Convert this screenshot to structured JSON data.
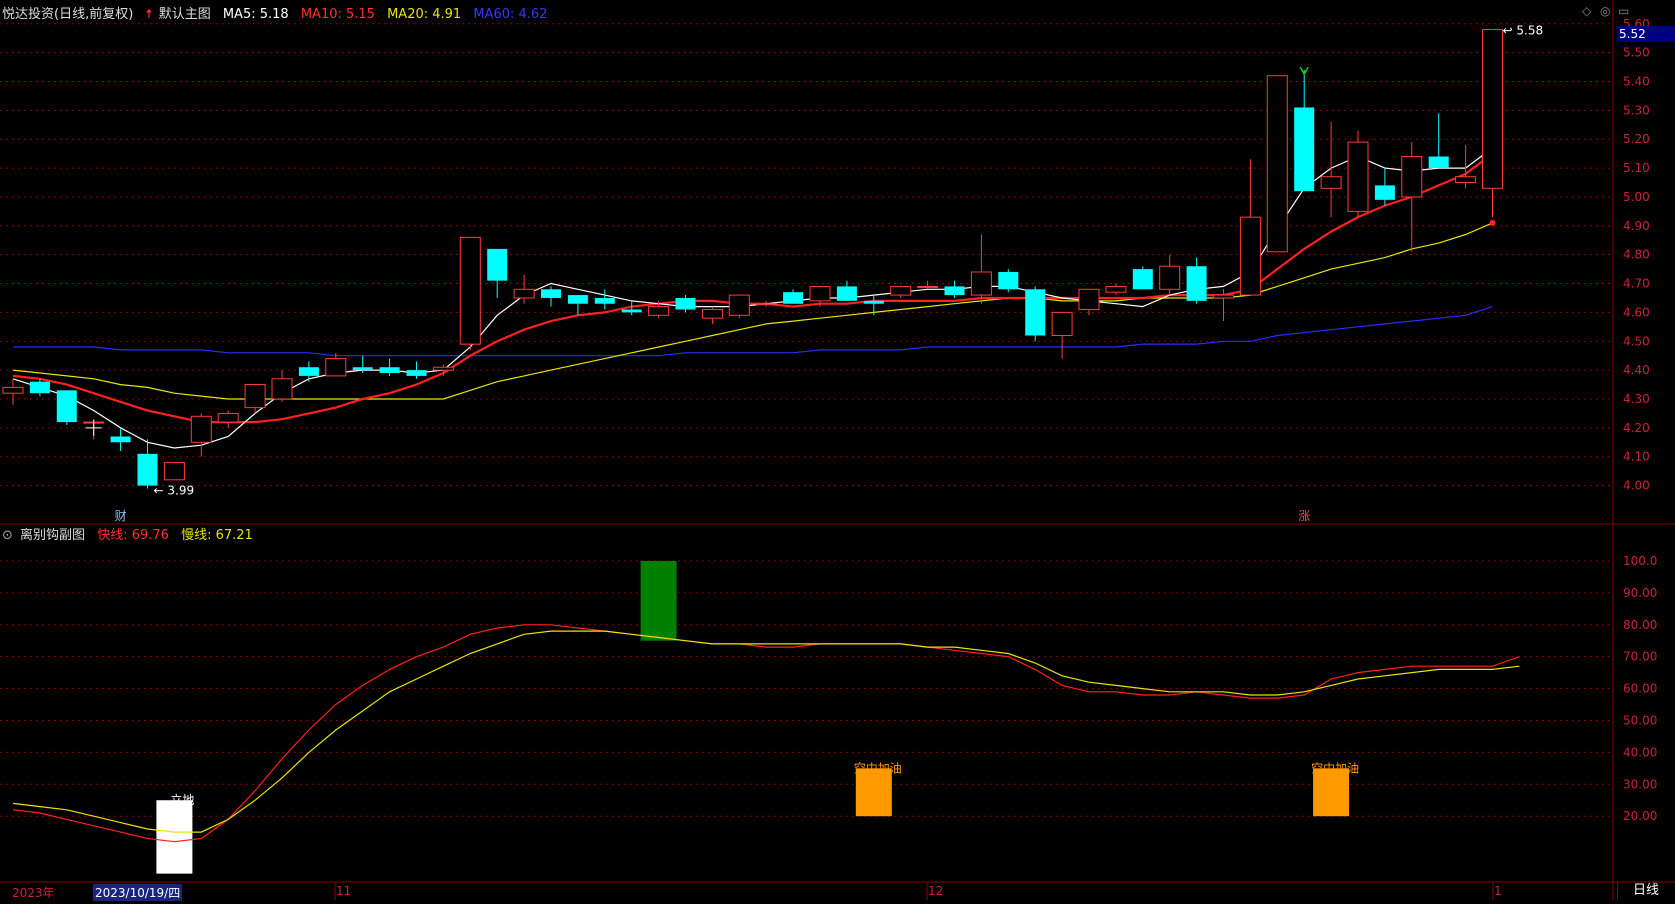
{
  "main_header": {
    "title": "悦达投资(日线,前复权)",
    "arrow_icon": "up-arrow-icon",
    "template": "默认主图",
    "ma5": "MA5: 5.18",
    "ma10": "MA10: 5.15",
    "ma20": "MA20: 4.91",
    "ma60": "MA60: 4.62",
    "colors": {
      "ma5": "#ffffff",
      "ma10": "#ff3030",
      "ma20": "#e6e600",
      "ma60": "#3030ff"
    }
  },
  "sub_header": {
    "title": "离别钩副图",
    "fast": "快线: 69.76",
    "slow": "慢线: 67.21"
  },
  "bottom_bar": {
    "year": "2023年",
    "cursor_date": "2023/10/19/四",
    "months": [
      "11",
      "12",
      "1"
    ],
    "period_button": "日线"
  },
  "price_tag": "5.52",
  "colors": {
    "up": "#ff3b3b",
    "down": "#00ffff",
    "grid": "#8b0000",
    "bg": "#000000"
  },
  "chart_data": [
    {
      "type": "candlestick",
      "title": "悦达投资(日线,前复权)",
      "ylim": [
        3.95,
        5.62
      ],
      "yticks": [
        "4.00",
        "4.10",
        "4.20",
        "4.30",
        "4.40",
        "4.50",
        "4.60",
        "4.70",
        "4.80",
        "4.90",
        "5.00",
        "5.10",
        "5.20",
        "5.30",
        "5.40",
        "5.50",
        "5.60"
      ],
      "candles": [
        {
          "o": 4.32,
          "h": 4.37,
          "l": 4.28,
          "c": 4.34
        },
        {
          "o": 4.36,
          "h": 4.37,
          "l": 4.31,
          "c": 4.32
        },
        {
          "o": 4.33,
          "h": 4.33,
          "l": 4.21,
          "c": 4.22
        },
        {
          "o": 4.22,
          "h": 4.23,
          "l": 4.16,
          "c": 4.22
        },
        {
          "o": 4.17,
          "h": 4.2,
          "l": 4.12,
          "c": 4.15
        },
        {
          "o": 4.11,
          "h": 4.16,
          "l": 3.99,
          "c": 4.0
        },
        {
          "o": 4.02,
          "h": 4.08,
          "l": 4.02,
          "c": 4.08
        },
        {
          "o": 4.15,
          "h": 4.25,
          "l": 4.1,
          "c": 4.24
        },
        {
          "o": 4.22,
          "h": 4.26,
          "l": 4.2,
          "c": 4.25
        },
        {
          "o": 4.27,
          "h": 4.35,
          "l": 4.25,
          "c": 4.35
        },
        {
          "o": 4.3,
          "h": 4.4,
          "l": 4.29,
          "c": 4.37
        },
        {
          "o": 4.41,
          "h": 4.43,
          "l": 4.36,
          "c": 4.38
        },
        {
          "o": 4.38,
          "h": 4.46,
          "l": 4.38,
          "c": 4.44
        },
        {
          "o": 4.41,
          "h": 4.45,
          "l": 4.39,
          "c": 4.4
        },
        {
          "o": 4.41,
          "h": 4.44,
          "l": 4.38,
          "c": 4.39
        },
        {
          "o": 4.4,
          "h": 4.43,
          "l": 4.37,
          "c": 4.38
        },
        {
          "o": 4.4,
          "h": 4.42,
          "l": 4.38,
          "c": 4.41
        },
        {
          "o": 4.49,
          "h": 4.86,
          "l": 4.47,
          "c": 4.86
        },
        {
          "o": 4.82,
          "h": 4.82,
          "l": 4.65,
          "c": 4.71
        },
        {
          "o": 4.65,
          "h": 4.73,
          "l": 4.63,
          "c": 4.68
        },
        {
          "o": 4.68,
          "h": 4.69,
          "l": 4.62,
          "c": 4.65
        },
        {
          "o": 4.66,
          "h": 4.66,
          "l": 4.59,
          "c": 4.63
        },
        {
          "o": 4.65,
          "h": 4.68,
          "l": 4.61,
          "c": 4.63
        },
        {
          "o": 4.61,
          "h": 4.64,
          "l": 4.59,
          "c": 4.6
        },
        {
          "o": 4.59,
          "h": 4.64,
          "l": 4.58,
          "c": 4.62
        },
        {
          "o": 4.65,
          "h": 4.66,
          "l": 4.6,
          "c": 4.61
        },
        {
          "o": 4.58,
          "h": 4.62,
          "l": 4.56,
          "c": 4.61
        },
        {
          "o": 4.59,
          "h": 4.66,
          "l": 4.58,
          "c": 4.66
        },
        {
          "o": 4.63,
          "h": 4.64,
          "l": 4.62,
          "c": 4.63
        },
        {
          "o": 4.67,
          "h": 4.68,
          "l": 4.63,
          "c": 4.63
        },
        {
          "o": 4.64,
          "h": 4.69,
          "l": 4.62,
          "c": 4.69
        },
        {
          "o": 4.69,
          "h": 4.71,
          "l": 4.64,
          "c": 4.64
        },
        {
          "o": 4.64,
          "h": 4.66,
          "l": 4.59,
          "c": 4.63
        },
        {
          "o": 4.66,
          "h": 4.69,
          "l": 4.65,
          "c": 4.69
        },
        {
          "o": 4.69,
          "h": 4.71,
          "l": 4.68,
          "c": 4.69
        },
        {
          "o": 4.69,
          "h": 4.71,
          "l": 4.65,
          "c": 4.66
        },
        {
          "o": 4.66,
          "h": 4.87,
          "l": 4.63,
          "c": 4.74
        },
        {
          "o": 4.74,
          "h": 4.75,
          "l": 4.67,
          "c": 4.68
        },
        {
          "o": 4.68,
          "h": 4.69,
          "l": 4.5,
          "c": 4.52
        },
        {
          "o": 4.52,
          "h": 4.6,
          "l": 4.44,
          "c": 4.6
        },
        {
          "o": 4.61,
          "h": 4.68,
          "l": 4.59,
          "c": 4.68
        },
        {
          "o": 4.67,
          "h": 4.7,
          "l": 4.66,
          "c": 4.69
        },
        {
          "o": 4.75,
          "h": 4.76,
          "l": 4.68,
          "c": 4.68
        },
        {
          "o": 4.68,
          "h": 4.8,
          "l": 4.66,
          "c": 4.76
        },
        {
          "o": 4.76,
          "h": 4.79,
          "l": 4.63,
          "c": 4.64
        },
        {
          "o": 4.65,
          "h": 4.68,
          "l": 4.57,
          "c": 4.66
        },
        {
          "o": 4.66,
          "h": 5.13,
          "l": 4.66,
          "c": 4.93
        },
        {
          "o": 4.81,
          "h": 5.42,
          "l": 4.81,
          "c": 5.42
        },
        {
          "o": 5.31,
          "h": 5.44,
          "l": 5.02,
          "c": 5.02
        },
        {
          "o": 5.03,
          "h": 5.26,
          "l": 4.93,
          "c": 5.07
        },
        {
          "o": 4.95,
          "h": 5.23,
          "l": 4.93,
          "c": 5.19
        },
        {
          "o": 5.04,
          "h": 5.1,
          "l": 4.97,
          "c": 4.99
        },
        {
          "o": 5.0,
          "h": 5.19,
          "l": 4.81,
          "c": 5.14
        },
        {
          "o": 5.14,
          "h": 5.29,
          "l": 5.1,
          "c": 5.1
        },
        {
          "o": 5.05,
          "h": 5.18,
          "l": 5.03,
          "c": 5.07
        },
        {
          "o": 5.03,
          "h": 5.58,
          "l": 4.93,
          "c": 5.58
        }
      ],
      "ma5": [
        4.37,
        4.34,
        4.31,
        4.26,
        4.2,
        4.15,
        4.13,
        4.14,
        4.17,
        4.25,
        4.32,
        4.37,
        4.39,
        4.4,
        4.4,
        4.39,
        4.4,
        4.48,
        4.59,
        4.66,
        4.7,
        4.68,
        4.66,
        4.64,
        4.63,
        4.62,
        4.62,
        4.62,
        4.63,
        4.64,
        4.65,
        4.65,
        4.66,
        4.67,
        4.68,
        4.68,
        4.69,
        4.69,
        4.67,
        4.65,
        4.64,
        4.63,
        4.62,
        4.66,
        4.68,
        4.69,
        4.74,
        4.89,
        5.03,
        5.1,
        5.14,
        5.1,
        5.09,
        5.1,
        5.1,
        5.17
      ],
      "ma10": [
        4.38,
        4.37,
        4.35,
        4.32,
        4.29,
        4.26,
        4.24,
        4.22,
        4.22,
        4.22,
        4.23,
        4.25,
        4.27,
        4.3,
        4.32,
        4.35,
        4.39,
        4.45,
        4.5,
        4.54,
        4.57,
        4.59,
        4.6,
        4.62,
        4.63,
        4.64,
        4.64,
        4.63,
        4.63,
        4.62,
        4.63,
        4.63,
        4.64,
        4.64,
        4.64,
        4.64,
        4.65,
        4.65,
        4.65,
        4.65,
        4.65,
        4.65,
        4.65,
        4.66,
        4.66,
        4.66,
        4.68,
        4.75,
        4.82,
        4.88,
        4.93,
        4.97,
        5.0,
        5.04,
        5.08,
        5.15
      ],
      "ma20": [
        4.4,
        4.39,
        4.38,
        4.37,
        4.35,
        4.34,
        4.32,
        4.31,
        4.3,
        4.3,
        4.3,
        4.3,
        4.3,
        4.3,
        4.3,
        4.3,
        4.3,
        4.33,
        4.36,
        4.38,
        4.4,
        4.42,
        4.44,
        4.46,
        4.48,
        4.5,
        4.52,
        4.54,
        4.56,
        4.57,
        4.58,
        4.59,
        4.6,
        4.61,
        4.62,
        4.63,
        4.64,
        4.65,
        4.65,
        4.64,
        4.64,
        4.64,
        4.65,
        4.65,
        4.65,
        4.65,
        4.66,
        4.69,
        4.72,
        4.75,
        4.77,
        4.79,
        4.82,
        4.84,
        4.87,
        4.91
      ],
      "ma60": [
        4.48,
        4.48,
        4.48,
        4.48,
        4.47,
        4.47,
        4.47,
        4.47,
        4.46,
        4.46,
        4.46,
        4.46,
        4.45,
        4.45,
        4.45,
        4.45,
        4.45,
        4.45,
        4.45,
        4.45,
        4.45,
        4.45,
        4.45,
        4.45,
        4.45,
        4.46,
        4.46,
        4.46,
        4.46,
        4.46,
        4.47,
        4.47,
        4.47,
        4.47,
        4.48,
        4.48,
        4.48,
        4.48,
        4.48,
        4.48,
        4.48,
        4.48,
        4.49,
        4.49,
        4.49,
        4.5,
        4.5,
        4.52,
        4.53,
        4.54,
        4.55,
        4.56,
        4.57,
        4.58,
        4.59,
        4.62
      ],
      "annotations": [
        {
          "type": "low",
          "index": 5,
          "price": 3.99,
          "text": "3.99"
        },
        {
          "type": "high",
          "index": 55,
          "price": 5.58,
          "text": "5.58"
        },
        {
          "type": "marker",
          "index": 4,
          "text": "财"
        },
        {
          "type": "marker",
          "index": 48,
          "text": "涨"
        }
      ]
    },
    {
      "type": "line",
      "title": "离别钩副图",
      "ylim": [
        0,
        105
      ],
      "yticks": [
        "20.00",
        "30.00",
        "40.00",
        "50.00",
        "60.00",
        "70.00",
        "80.00",
        "90.00",
        "100.0"
      ],
      "series": [
        {
          "name": "快线",
          "color": "#ff2020",
          "values": [
            22,
            21,
            19,
            17,
            15,
            13,
            12,
            13,
            19,
            28,
            38,
            47,
            55,
            61,
            66,
            70,
            73,
            77,
            79,
            80,
            80,
            79,
            78,
            77,
            76,
            75,
            74,
            74,
            73,
            73,
            74,
            74,
            74,
            74,
            73,
            72,
            71,
            70,
            66,
            61,
            59,
            59,
            58,
            58,
            59,
            58,
            57,
            57,
            58,
            63,
            65,
            66,
            67,
            67,
            67,
            67,
            70
          ]
        },
        {
          "name": "慢线",
          "color": "#e6e600",
          "values": [
            24,
            23,
            22,
            20,
            18,
            16,
            15,
            15,
            19,
            25,
            32,
            40,
            47,
            53,
            59,
            63,
            67,
            71,
            74,
            77,
            78,
            78,
            78,
            77,
            76,
            75,
            74,
            74,
            74,
            74,
            74,
            74,
            74,
            74,
            73,
            73,
            72,
            71,
            68,
            64,
            62,
            61,
            60,
            59,
            59,
            59,
            58,
            58,
            59,
            61,
            63,
            64,
            65,
            66,
            66,
            66,
            67
          ]
        }
      ],
      "bars": [
        {
          "label": "立地",
          "index": 6,
          "from": 2,
          "to": 25,
          "color": "#ffffff"
        },
        {
          "label": "",
          "index": 24,
          "from": 75,
          "to": 100,
          "color": "#008000"
        },
        {
          "label": "空中加油",
          "index": 32,
          "from": 20,
          "to": 35,
          "color": "#ff9900"
        },
        {
          "label": "空中加油",
          "index": 49,
          "from": 20,
          "to": 35,
          "color": "#ff9900"
        }
      ]
    }
  ]
}
